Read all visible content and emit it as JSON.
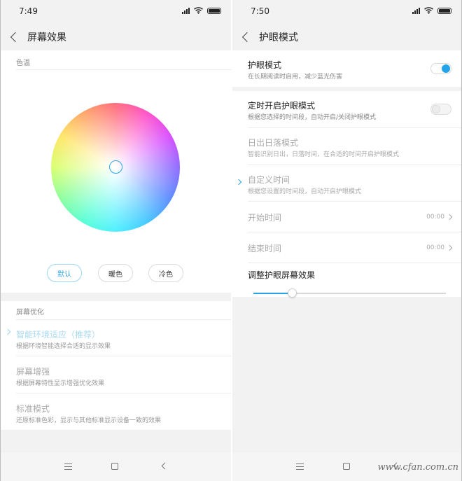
{
  "left": {
    "status": {
      "time": "7:49"
    },
    "header": {
      "title": "屏幕效果"
    },
    "color_temp": {
      "section_label": "色温",
      "presets": [
        {
          "label": "默认",
          "selected": true
        },
        {
          "label": "暖色",
          "selected": false
        },
        {
          "label": "冷色",
          "selected": false
        }
      ]
    },
    "screen_opt": {
      "section_label": "屏幕优化",
      "items": [
        {
          "title": "智能环境适应（推荐）",
          "subtitle": "根据环境智能选择合适的显示效果",
          "selected": true
        },
        {
          "title": "屏幕增强",
          "subtitle": "根据屏幕特性显示增强优化效果",
          "selected": false
        },
        {
          "title": "标准模式",
          "subtitle": "还原标准色彩，显示与其他标准显示设备一致的效果",
          "selected": false
        }
      ]
    }
  },
  "right": {
    "status": {
      "time": "7:50"
    },
    "header": {
      "title": "护眼模式"
    },
    "eye_mode": {
      "title": "护眼模式",
      "subtitle": "在长期阅读时启用，减少蓝光伤害",
      "enabled": true
    },
    "schedule": {
      "title": "定时开启护眼模式",
      "subtitle": "根据您选择的时间段，自动开启/关闭护眼模式",
      "enabled": false
    },
    "sunset": {
      "title": "日出日落模式",
      "subtitle": "智能识别日出，日落时间，在合适的时间开启护眼模式"
    },
    "custom": {
      "title": "自定义时间",
      "subtitle": "根据您设置的时间段，自动开启护眼模式",
      "selected": true
    },
    "start": {
      "label": "开始时间",
      "value": "00:00"
    },
    "end": {
      "label": "结束时间",
      "value": "00:00"
    },
    "adjust": {
      "label": "调整护眼屏幕效果",
      "level": 0.2
    }
  },
  "watermark": "www.cfan.com.cn",
  "colors": {
    "accent": "#23a3ea",
    "background": "#f2f2f2"
  }
}
